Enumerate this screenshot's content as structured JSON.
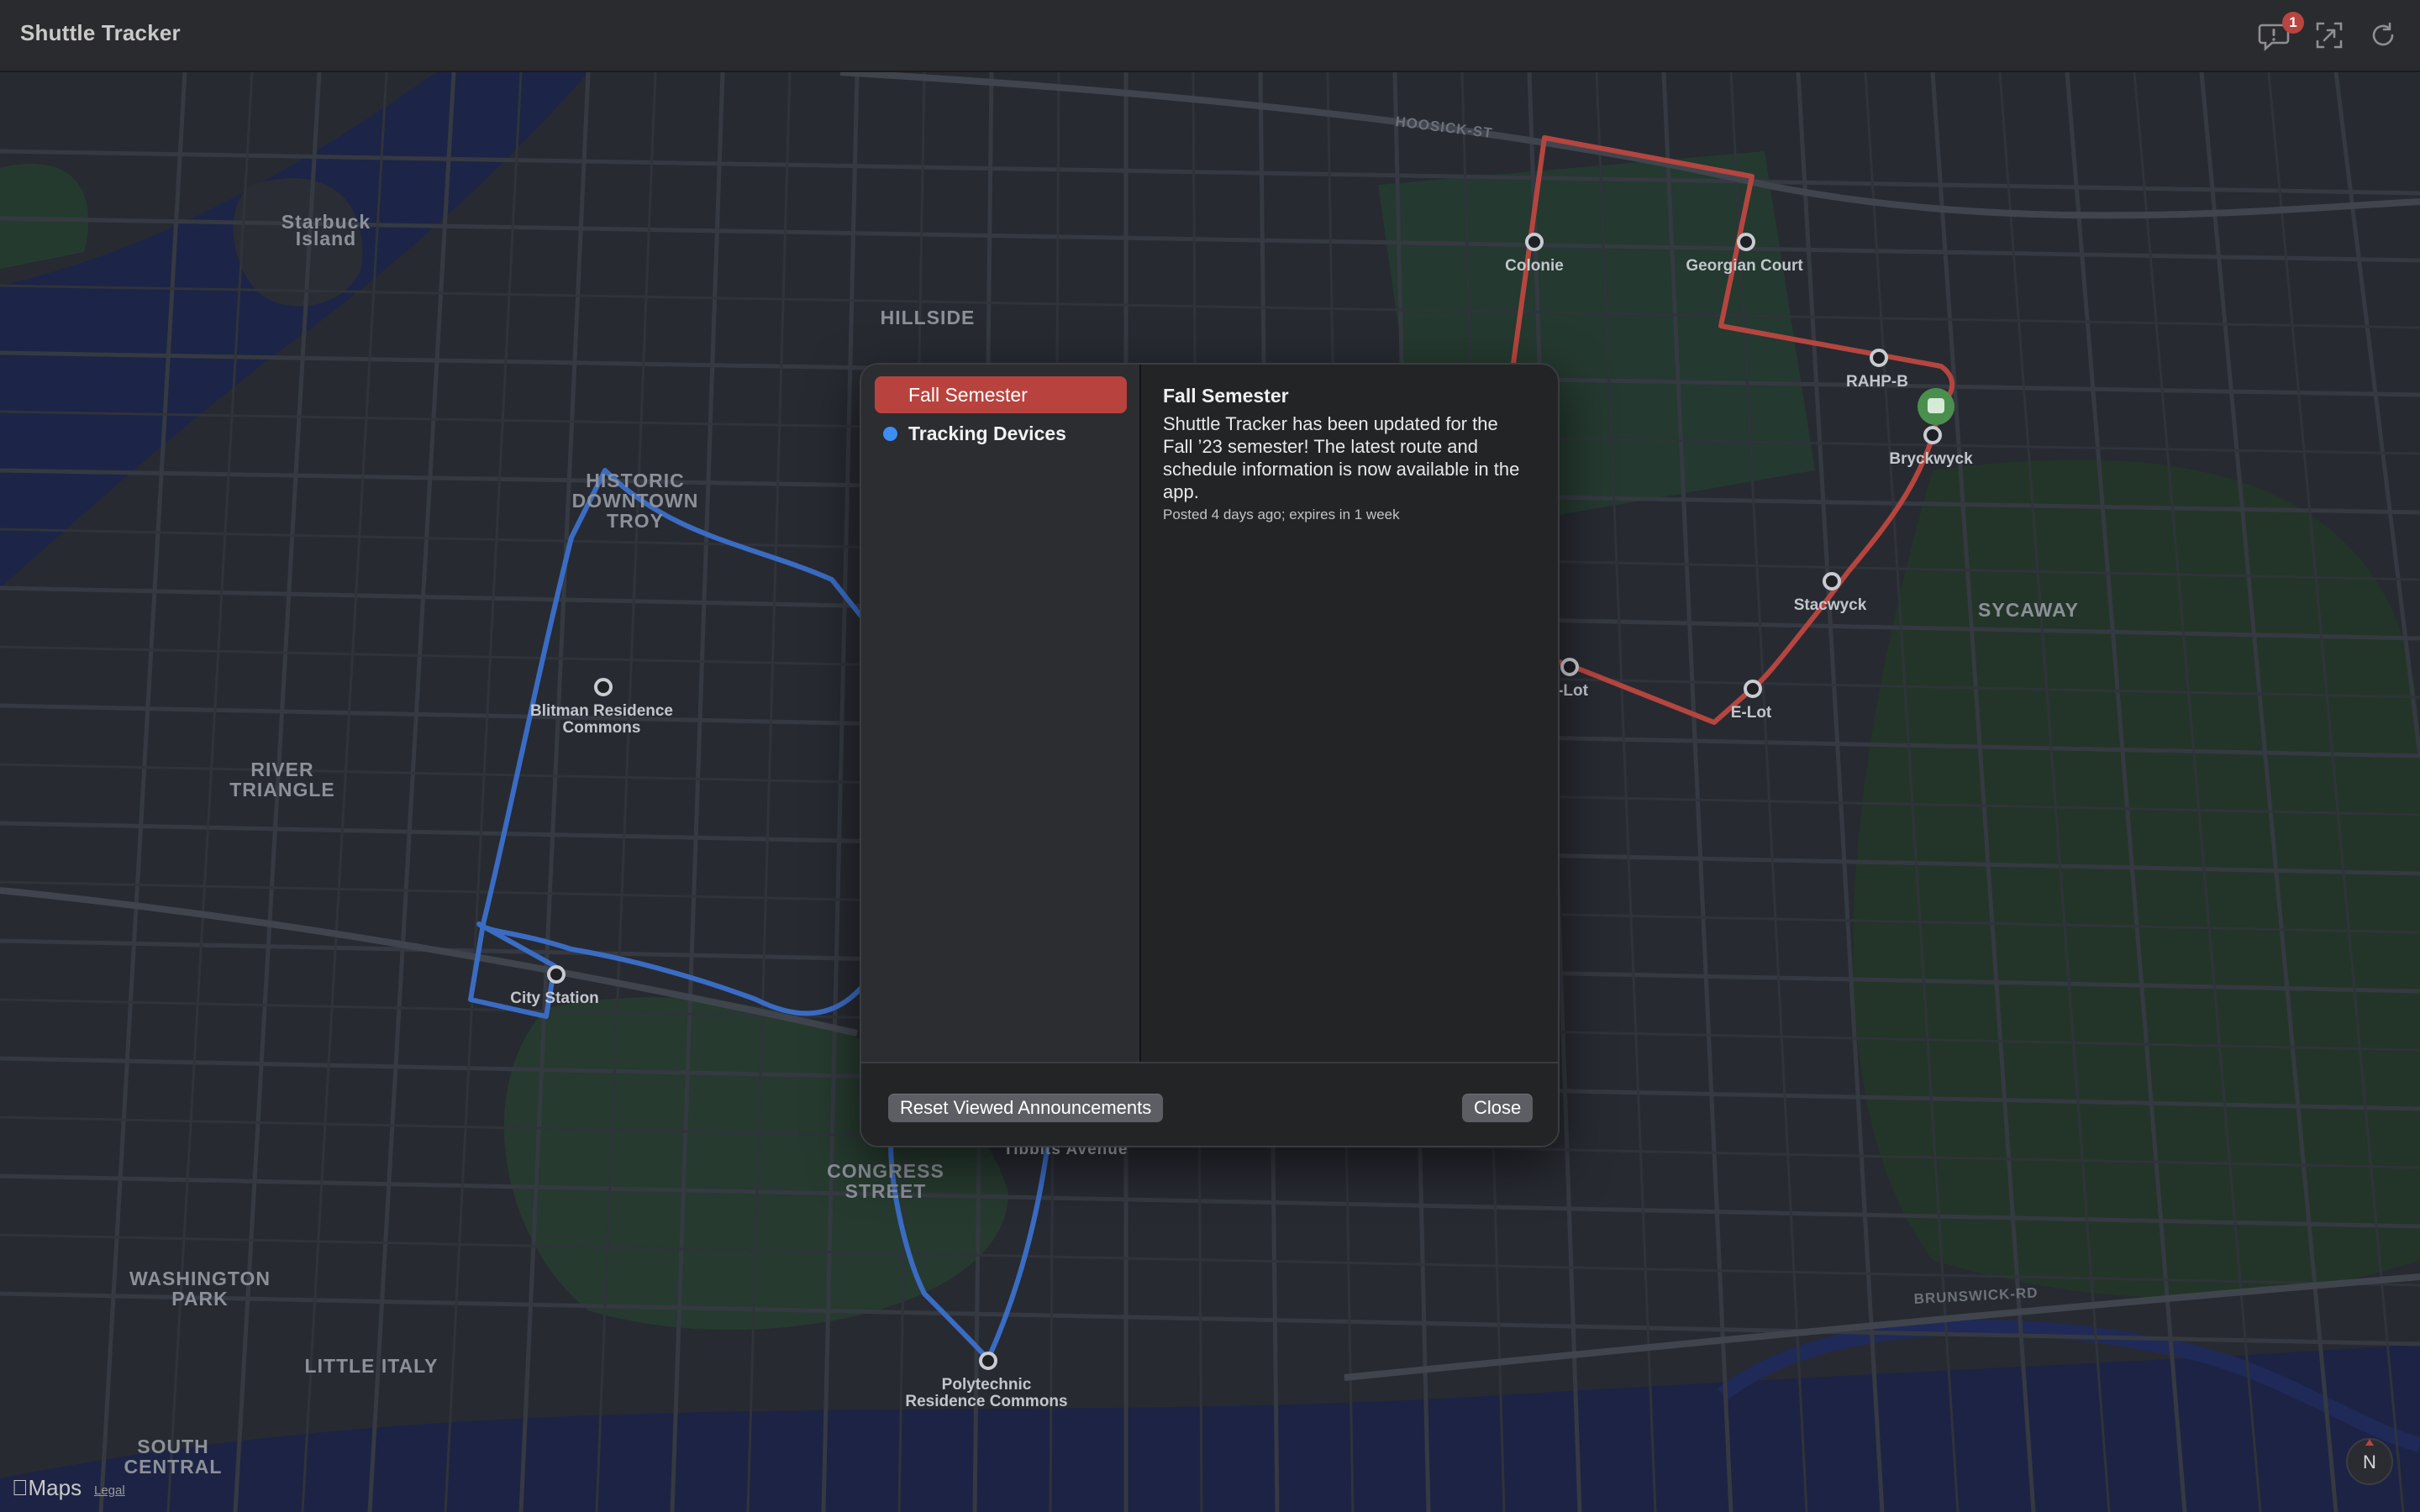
{
  "app": {
    "title": "Shuttle Tracker"
  },
  "toolbar": {
    "announcements_badge": "1"
  },
  "map": {
    "stops": [
      "Colonie",
      "Georgian Court",
      "RAHP-B",
      "Bryckwyck",
      "Stacwyck",
      "E-Lot",
      "-Lot",
      "Blitman Residence",
      "Commons",
      "City Station",
      "Polytechnic",
      "Residence Commons"
    ],
    "areas": [
      "Starbuck",
      "Island",
      "HILLSIDE",
      "HISTORIC",
      "DOWNTOWN",
      "TROY",
      "RIVER",
      "TRIANGLE",
      "SYCAWAY",
      "CONGRESS",
      "STREET",
      "WASHINGTON",
      "PARK",
      "LITTLE ITALY",
      "SOUTH",
      "CENTRAL"
    ],
    "roads": [
      "HOOSICK-ST",
      "BRUNSWICK-RD",
      "Tibbits Avenue"
    ],
    "route_colors": {
      "north": "#b5453f",
      "south": "#3a6cc4"
    },
    "credit": "Maps",
    "legal": "Legal",
    "compass": "N"
  },
  "announcements": {
    "items": [
      {
        "title": "Fall Semester",
        "state": "selected"
      },
      {
        "title": "Tracking Devices",
        "state": "unread"
      }
    ],
    "detail": {
      "title": "Fall Semester",
      "body": "Shuttle Tracker has been updated for the Fall ’23 semester! The latest route and schedule information is now available in the app.",
      "meta": "Posted 4 days ago; expires in 1 week"
    },
    "reset_label": "Reset Viewed Announcements",
    "close_label": "Close"
  }
}
